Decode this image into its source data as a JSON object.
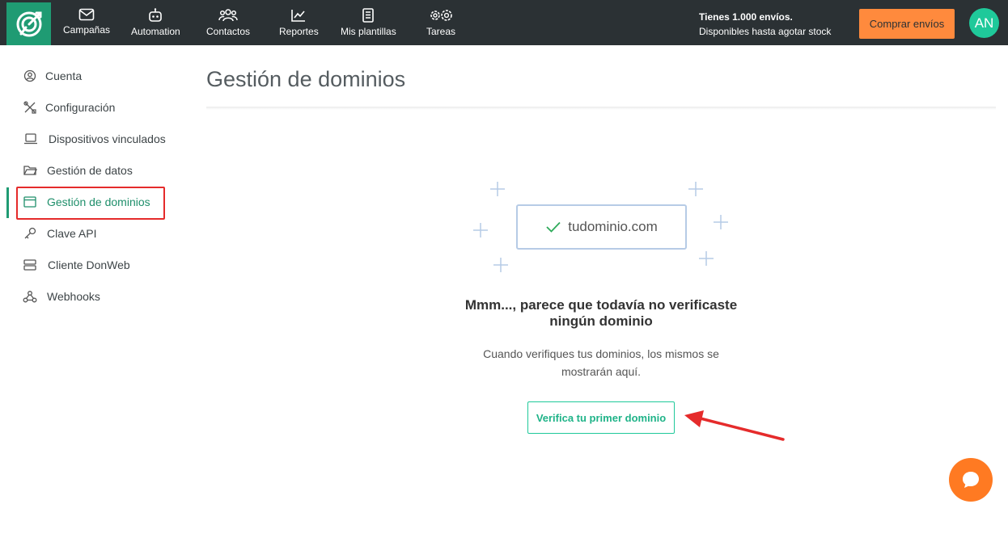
{
  "app": {
    "colors": {
      "brand": "#1f9b73",
      "topbar": "#2b3134",
      "accent_orange": "#ff8a3d",
      "annotation_red": "#e52b2b"
    }
  },
  "topnav": {
    "items": [
      {
        "label": "Campañas",
        "icon": "mail-icon"
      },
      {
        "label": "Automation",
        "icon": "robot-icon"
      },
      {
        "label": "Contactos",
        "icon": "users-icon"
      },
      {
        "label": "Reportes",
        "icon": "chart-icon"
      },
      {
        "label": "Mis plantillas",
        "icon": "document-icon"
      },
      {
        "label": "Tareas",
        "icon": "gears-icon"
      }
    ],
    "envios_line1": "Tienes 1.000 envíos.",
    "envios_line2": "Disponibles hasta agotar stock",
    "buy_button": "Comprar envíos",
    "avatar_initials": "AN"
  },
  "sidebar": {
    "items": [
      {
        "label": "Cuenta",
        "icon": "user-circle-icon"
      },
      {
        "label": "Configuración",
        "icon": "tools-icon"
      },
      {
        "label": "Dispositivos vinculados",
        "icon": "laptop-icon"
      },
      {
        "label": "Gestión de datos",
        "icon": "folder-icon"
      },
      {
        "label": "Gestión de dominios",
        "icon": "browser-window-icon",
        "active": true
      },
      {
        "label": "Clave API",
        "icon": "key-icon"
      },
      {
        "label": "Cliente DonWeb",
        "icon": "server-icon"
      },
      {
        "label": "Webhooks",
        "icon": "webhook-icon"
      }
    ]
  },
  "main": {
    "title": "Gestión de dominios",
    "illustration_domain": "tudominio.com",
    "empty_title_line1": "Mmm..., parece que todavía no verificaste",
    "empty_title_line2": "ningún dominio",
    "empty_desc_line1": "Cuando verifiques tus dominios, los mismos se",
    "empty_desc_line2": "mostrarán aquí.",
    "verify_button": "Verifica tu primer dominio"
  }
}
